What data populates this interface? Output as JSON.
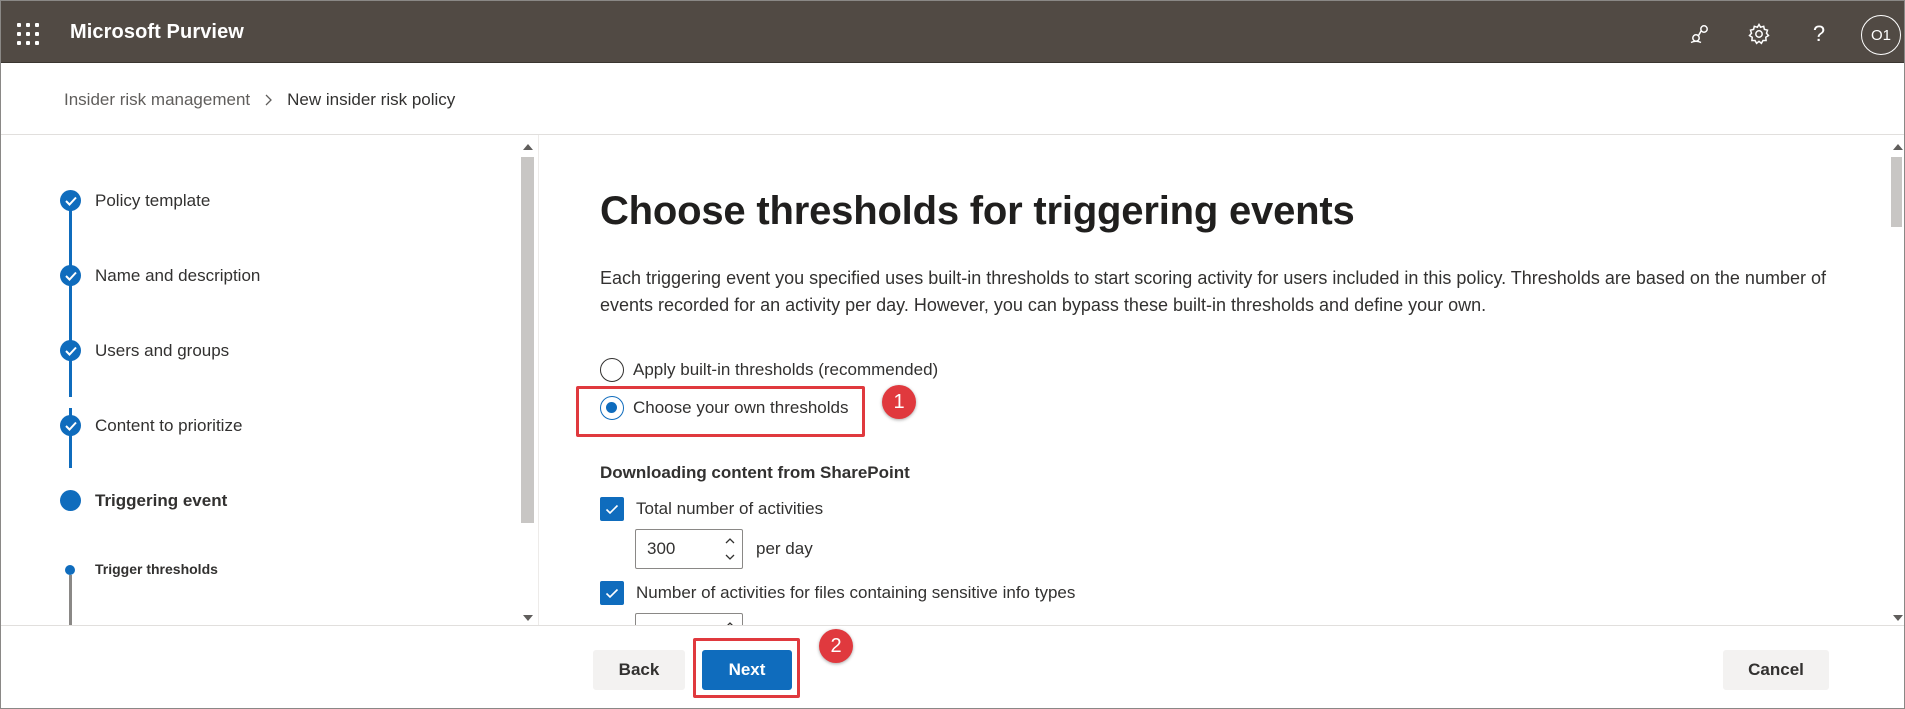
{
  "header": {
    "app_title": "Microsoft Purview",
    "icons": [
      "app-launcher-icon",
      "share-icon",
      "settings-icon",
      "help-icon"
    ],
    "avatar_initials": "O1",
    "background": "#514a44"
  },
  "breadcrumb": {
    "parent": "Insider risk management",
    "current": "New insider risk policy"
  },
  "steps": [
    {
      "label": "Policy template",
      "status": "completed"
    },
    {
      "label": "Name and description",
      "status": "completed"
    },
    {
      "label": "Users and groups",
      "status": "completed"
    },
    {
      "label": "Content to prioritize",
      "status": "completed"
    },
    {
      "label": "Triggering event",
      "status": "current"
    },
    {
      "label": "Trigger thresholds",
      "status": "current-substep"
    }
  ],
  "main": {
    "title": "Choose thresholds for triggering events",
    "description": "Each triggering event you specified uses built-in thresholds to start scoring activity for users included in this policy. Thresholds are based on the number of events recorded for an activity per day. However, you can bypass these built-in thresholds and define your own.",
    "options": [
      {
        "label": "Apply built-in thresholds (recommended)",
        "selected": false
      },
      {
        "label": "Choose your own thresholds",
        "selected": true
      }
    ],
    "section_title": "Downloading content from SharePoint",
    "checks": [
      {
        "label": "Total number of activities",
        "checked": true,
        "value": "300",
        "unit": "per day"
      },
      {
        "label": "Number of activities for files containing sensitive info types",
        "checked": true
      }
    ]
  },
  "footer": {
    "back_label": "Back",
    "next_label": "Next",
    "cancel_label": "Cancel"
  },
  "annotations": [
    {
      "number": "1",
      "target": "Choose your own thresholds"
    },
    {
      "number": "2",
      "target": "Next"
    }
  ],
  "colors": {
    "accent": "#0f6cbd",
    "annotation": "#e0393e"
  }
}
